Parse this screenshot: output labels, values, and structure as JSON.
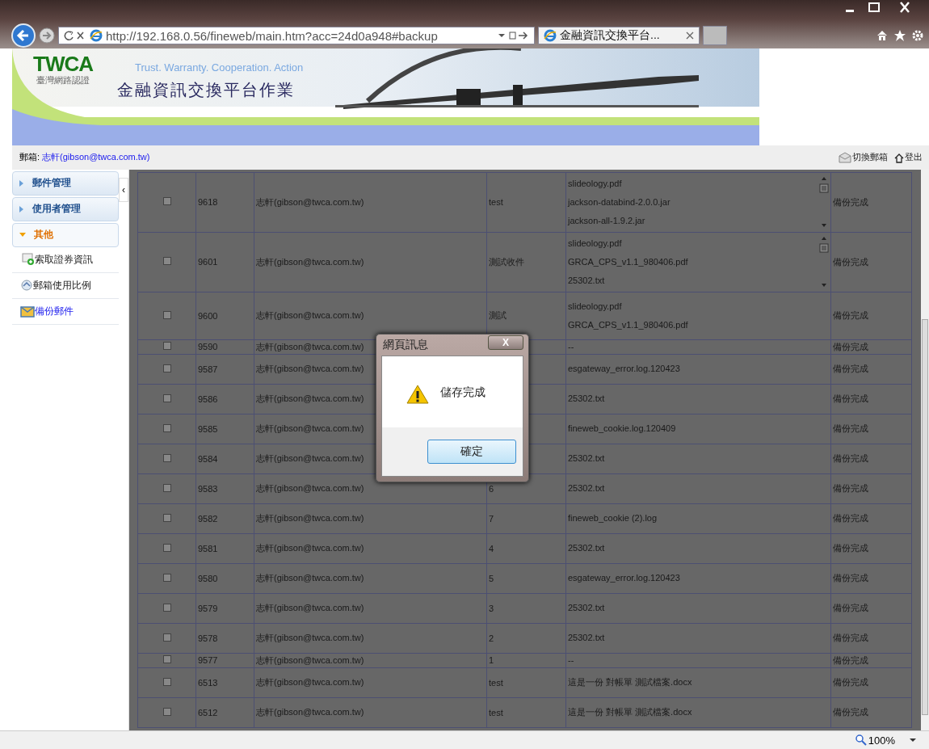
{
  "browser": {
    "address": "http://192.168.0.56/fineweb/main.htm?acc=24d0a948#backup",
    "tab_title": "金融資訊交換平台...",
    "zoom": "100%"
  },
  "banner": {
    "logo": "TWCA",
    "logo_subtitle": "臺灣網路認證",
    "slogan": "Trust. Warranty. Cooperation. Action",
    "title": "金融資訊交換平台作業"
  },
  "user_bar": {
    "mailbox_label": "郵箱:",
    "mailbox": "志軒(gibson@twca.com.tw)",
    "switch_mailbox": "切換郵箱",
    "logout": "登出"
  },
  "sidebar": {
    "collapse": "‹",
    "groups": [
      {
        "label": "郵件管理",
        "expanded": false
      },
      {
        "label": "使用者管理",
        "expanded": false
      },
      {
        "label": "其他",
        "expanded": true,
        "items": [
          {
            "label": "索取證券資訊",
            "selected": false
          },
          {
            "label": "郵箱使用比例",
            "selected": false
          },
          {
            "label": "備份郵件",
            "selected": true
          }
        ]
      }
    ]
  },
  "table": {
    "rows": [
      {
        "checked": false,
        "id": "9618",
        "sender": "志軒(gibson@twca.com.tw)",
        "subject": "test",
        "files": [
          "slideology.pdf",
          "jackson-databind-2.0.0.jar",
          "jackson-all-1.9.2.jar"
        ],
        "status": "備份完成"
      },
      {
        "checked": false,
        "id": "9601",
        "sender": "志軒(gibson@twca.com.tw)",
        "subject": "測試收件",
        "files": [
          "slideology.pdf",
          "GRCA_CPS_v1.1_980406.pdf",
          "25302.txt"
        ],
        "status": "備份完成"
      },
      {
        "checked": false,
        "id": "9600",
        "sender": "志軒(gibson@twca.com.tw)",
        "subject": "測試",
        "files": [
          "slideology.pdf",
          "GRCA_CPS_v1.1_980406.pdf"
        ],
        "status": "備份完成"
      },
      {
        "checked": false,
        "id": "9590",
        "sender": "志軒(gibson@twca.com.tw)",
        "files": [
          "--"
        ],
        "status": "備份完成"
      },
      {
        "checked": false,
        "id": "9587",
        "sender": "志軒(gibson@twca.com.tw)",
        "files": [
          "esgateway_error.log.120423"
        ],
        "status": "備份完成"
      },
      {
        "checked": false,
        "id": "9586",
        "sender": "志軒(gibson@twca.com.tw)",
        "files": [
          "25302.txt"
        ],
        "status": "備份完成"
      },
      {
        "checked": false,
        "id": "9585",
        "sender": "志軒(gibson@twca.com.tw)",
        "files": [
          "fineweb_cookie.log.120409"
        ],
        "status": "備份完成"
      },
      {
        "checked": false,
        "id": "9584",
        "sender": "志軒(gibson@twca.com.tw)",
        "files": [
          "25302.txt"
        ],
        "status": "備份完成"
      },
      {
        "checked": false,
        "id": "9583",
        "sender": "志軒(gibson@twca.com.tw)",
        "subject": "6",
        "files": [
          "25302.txt"
        ],
        "status": "備份完成"
      },
      {
        "checked": false,
        "id": "9582",
        "sender": "志軒(gibson@twca.com.tw)",
        "subject": "7",
        "files": [
          "fineweb_cookie (2).log"
        ],
        "status": "備份完成"
      },
      {
        "checked": false,
        "id": "9581",
        "sender": "志軒(gibson@twca.com.tw)",
        "subject": "4",
        "files": [
          "25302.txt"
        ],
        "status": "備份完成"
      },
      {
        "checked": false,
        "id": "9580",
        "sender": "志軒(gibson@twca.com.tw)",
        "subject": "5",
        "files": [
          "esgateway_error.log.120423"
        ],
        "status": "備份完成"
      },
      {
        "checked": false,
        "id": "9579",
        "sender": "志軒(gibson@twca.com.tw)",
        "subject": "3",
        "files": [
          "25302.txt"
        ],
        "status": "備份完成"
      },
      {
        "checked": false,
        "id": "9578",
        "sender": "志軒(gibson@twca.com.tw)",
        "subject": "2",
        "files": [
          "25302.txt"
        ],
        "status": "備份完成"
      },
      {
        "checked": false,
        "id": "9577",
        "sender": "志軒(gibson@twca.com.tw)",
        "subject": "1",
        "files": [
          "--"
        ],
        "status": "備份完成"
      },
      {
        "checked": false,
        "id": "6513",
        "sender": "志軒(gibson@twca.com.tw)",
        "subject": "test",
        "files": [
          "這是一份 對帳單 測試檔案.docx"
        ],
        "status": "備份完成"
      },
      {
        "checked": false,
        "id": "6512",
        "sender": "志軒(gibson@twca.com.tw)",
        "subject": "test",
        "files": [
          "這是一份 對帳單 測試檔案.docx"
        ],
        "status": "備份完成"
      }
    ]
  },
  "dialog": {
    "title": "網頁訊息",
    "close": "X",
    "message": "儲存完成",
    "ok": "確定"
  }
}
